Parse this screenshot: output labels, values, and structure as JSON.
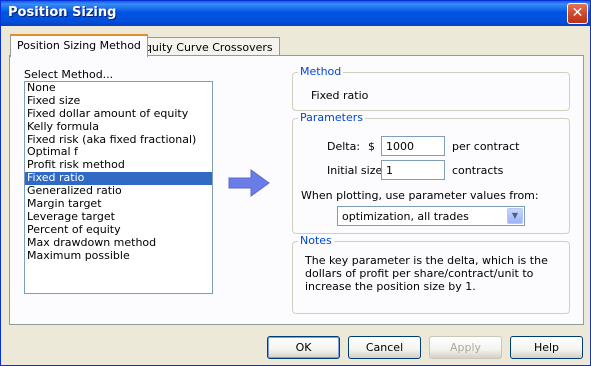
{
  "window": {
    "title": "Position Sizing",
    "close_icon": "close-icon"
  },
  "tabs": [
    {
      "label": "Position Sizing Method",
      "active": true
    },
    {
      "label": "Equity Curve Crossovers",
      "active": false
    }
  ],
  "method_list": {
    "label": "Select Method...",
    "items": [
      "None",
      "Fixed size",
      "Fixed dollar amount of equity",
      "Kelly formula",
      "Fixed risk (aka fixed fractional)",
      "Optimal f",
      "Profit risk method",
      "Fixed ratio",
      "Generalized ratio",
      "Margin target",
      "Leverage target",
      "Percent of equity",
      "Max drawdown method",
      "Maximum possible"
    ],
    "selected": "Fixed ratio"
  },
  "arrow": {
    "icon": "arrow-right-icon",
    "color": "#6a7de6"
  },
  "method_group": {
    "legend": "Method",
    "value": "Fixed ratio"
  },
  "parameters": {
    "legend": "Parameters",
    "delta_label": "Delta:",
    "delta_prefix": "$",
    "delta_value": "1000",
    "delta_unit": "per contract",
    "initial_label": "Initial size:",
    "initial_value": "1",
    "initial_unit": "contracts",
    "plotting_label": "When plotting, use parameter values from:",
    "plotting_value": "optimization, all trades"
  },
  "notes": {
    "legend": "Notes",
    "text": "The key parameter is the delta, which is the dollars of profit per share/contract/unit to increase the position size by 1."
  },
  "buttons": {
    "ok": "OK",
    "cancel": "Cancel",
    "apply": "Apply",
    "help": "Help"
  },
  "colors": {
    "title_bar": "#0054e3",
    "selection": "#316ac5",
    "legend": "#0046d5"
  }
}
